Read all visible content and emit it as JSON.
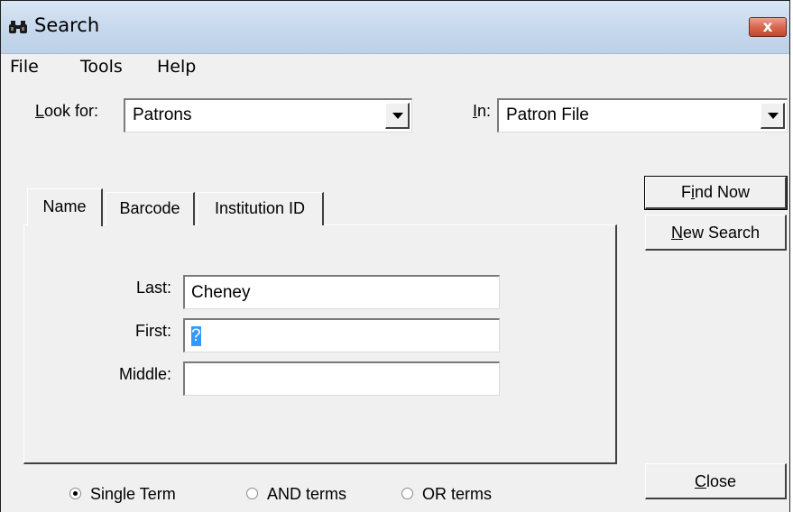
{
  "window": {
    "title": "Search",
    "close_glyph": "x"
  },
  "menu": [
    {
      "label": "File"
    },
    {
      "label": "Tools"
    },
    {
      "label": "Help"
    }
  ],
  "look_for": {
    "label_accel": "L",
    "label_rest": "ook for:",
    "value": "Patrons"
  },
  "in_field": {
    "label_accel": "I",
    "label_rest": "n:",
    "value": "Patron File"
  },
  "tabs": [
    {
      "label": "Name",
      "selected": true
    },
    {
      "label": "Barcode",
      "selected": false
    },
    {
      "label": "Institution ID",
      "selected": false
    }
  ],
  "fields": {
    "last": {
      "label": "Last:",
      "value": "Cheney"
    },
    "first": {
      "label": "First:",
      "value": "?"
    },
    "middle": {
      "label": "Middle:",
      "value": ""
    }
  },
  "buttons": {
    "find_now": {
      "accel": "i",
      "pre": "F",
      "post": "nd Now"
    },
    "new_search": {
      "accel": "N",
      "pre": "",
      "post": "ew Search"
    },
    "close": {
      "accel": "C",
      "pre": "",
      "post": "lose"
    }
  },
  "search_mode": {
    "options": [
      {
        "label": "Single Term",
        "selected": true
      },
      {
        "label": "AND terms",
        "selected": false
      },
      {
        "label": "OR terms",
        "selected": false
      }
    ]
  },
  "icons": {
    "title_icon": "binoculars-icon"
  },
  "colors": {
    "close_button": "#c4462c",
    "selection": "#3399ff"
  }
}
